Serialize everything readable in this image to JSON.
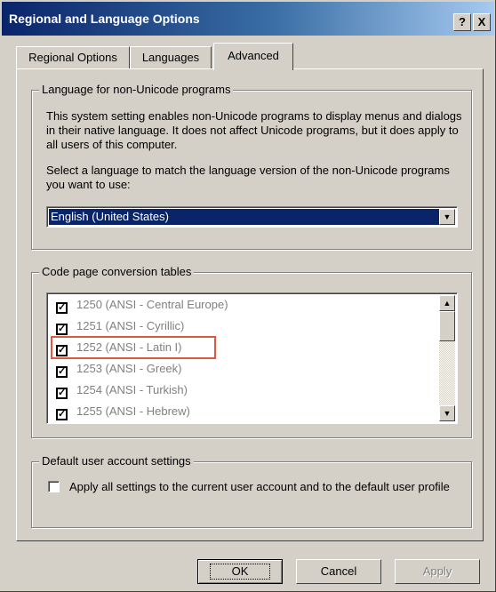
{
  "window": {
    "title": "Regional and Language Options",
    "help_button": "?",
    "close_button": "X"
  },
  "tabs": [
    {
      "label": "Regional Options",
      "active": false
    },
    {
      "label": "Languages",
      "active": false
    },
    {
      "label": "Advanced",
      "active": true
    }
  ],
  "non_unicode": {
    "group_label": "Language for non-Unicode programs",
    "description": "This system setting enables non-Unicode programs to display menus and dialogs in their native language. It does not affect Unicode programs, but it does apply to all users of this computer.",
    "select_prompt": "Select a language to match the language version of the non-Unicode programs you want to use:",
    "selected_language": "English (United States)"
  },
  "code_pages": {
    "group_label": "Code page conversion tables",
    "items": [
      {
        "label": "1250  (ANSI - Central Europe)",
        "checked": true
      },
      {
        "label": "1251  (ANSI - Cyrillic)",
        "checked": true
      },
      {
        "label": "1252  (ANSI - Latin I)",
        "checked": true,
        "highlighted": true
      },
      {
        "label": "1253  (ANSI - Greek)",
        "checked": true
      },
      {
        "label": "1254  (ANSI - Turkish)",
        "checked": true
      },
      {
        "label": "1255  (ANSI - Hebrew)",
        "checked": true
      }
    ]
  },
  "default_user": {
    "group_label": "Default user account settings",
    "option_label": "Apply all settings to the current user account and to the default user profile",
    "checked": false
  },
  "buttons": {
    "ok": "OK",
    "cancel": "Cancel",
    "apply": "Apply"
  },
  "colors": {
    "titlebar_start": "#0a246a",
    "titlebar_end": "#a6caf0",
    "selection": "#0a246a",
    "highlight_outline": "#e3573f",
    "face": "#d4d0c8"
  }
}
